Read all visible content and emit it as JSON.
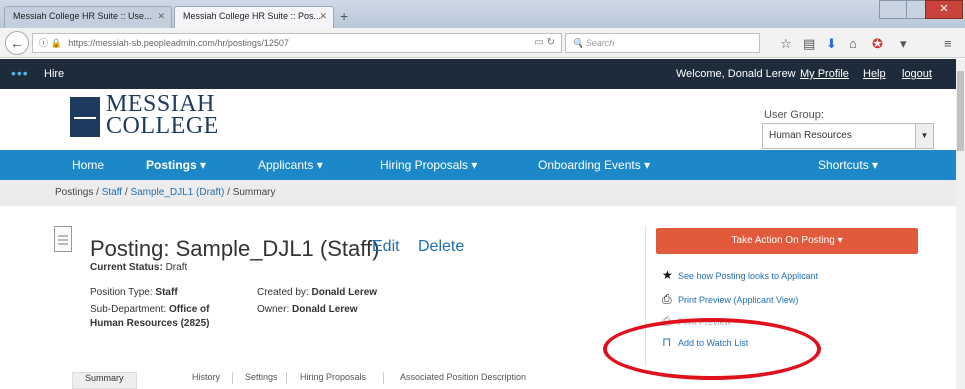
{
  "browser": {
    "tabs": [
      {
        "label": "Messiah College HR Suite :: Use..."
      },
      {
        "label": "Messiah College HR Suite :: Pos..."
      }
    ],
    "new_tab": "+",
    "url": "https://messiah-sb.peopleadmin.com/hr/postings/12507",
    "search_placeholder": "Search"
  },
  "appbar": {
    "section": "Hire",
    "welcome": "Welcome, Donald Lerew",
    "my_profile": "My Profile",
    "help": "Help",
    "logout": "logout"
  },
  "header": {
    "logo_line1": "MESSIAH",
    "logo_line2": "COLLEGE",
    "user_group_label": "User Group:",
    "user_group_value": "Human Resources"
  },
  "nav": {
    "home": "Home",
    "postings": "Postings ▾",
    "applicants": "Applicants ▾",
    "hiring_proposals": "Hiring Proposals ▾",
    "onboarding_events": "Onboarding Events ▾",
    "shortcuts": "Shortcuts ▾"
  },
  "breadcrumb": {
    "root": "Postings",
    "sep1": " / ",
    "staff": "Staff",
    "sep2": " / ",
    "posting": "Sample_DJL1 (Draft)",
    "sep3": " / ",
    "current": "Summary"
  },
  "posting": {
    "title": "Posting: Sample_DJL1 (Staff)",
    "edit": "Edit",
    "delete": "Delete",
    "status_label": "Current Status:",
    "status_value": "Draft",
    "position_type_label": "Position Type:",
    "position_type_value": "Staff",
    "subdept_label": "Sub-Department:",
    "subdept_value_1": "Office of",
    "subdept_value_2": "Human Resources (2825)",
    "created_by_label": "Created by:",
    "created_by_value": "Donald Lerew",
    "owner_label": "Owner:",
    "owner_value": "Donald Lerew"
  },
  "actions": {
    "take_action": "Take Action On Posting ▾",
    "see_applicant": "See how Posting looks to Applicant",
    "print_preview_applicant": "Print Preview (Applicant View)",
    "print_preview": "Print Preview",
    "add_watch": "Add to Watch List"
  },
  "subtabs": {
    "summary": "Summary",
    "history": "History",
    "settings": "Settings",
    "hiring_proposals": "Hiring Proposals",
    "assoc_position": "Associated Position Description"
  },
  "colors": {
    "appbar": "#1d2b3a",
    "nav": "#1c88c7",
    "accent_action": "#e25a3c",
    "annotation": "#e0101c",
    "link": "#1f6fb2"
  }
}
